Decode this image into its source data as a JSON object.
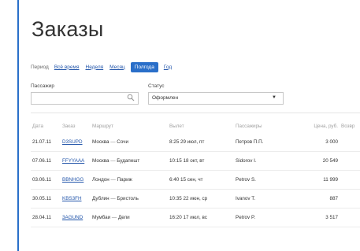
{
  "page": {
    "title": "Заказы"
  },
  "filters": {
    "period_label": "Период",
    "periods": [
      {
        "label": "Всё время",
        "active": false
      },
      {
        "label": "Неделя",
        "active": false
      },
      {
        "label": "Месяц",
        "active": false
      },
      {
        "label": "Полгода",
        "active": true
      },
      {
        "label": "Год",
        "active": false
      }
    ],
    "passenger_label": "Пассажир",
    "passenger_value": "",
    "status_label": "Статус",
    "status_value": "Оформлен"
  },
  "table": {
    "headers": [
      "Дата",
      "Заказ",
      "Маршрут",
      "Вылет",
      "Пассажиры",
      "Цена, руб.",
      "Возвр"
    ],
    "rows": [
      {
        "date": "21.07.11",
        "order": "D3SUPD",
        "from": "Москва",
        "to": "Сочи",
        "departure": "8:25 29 июл, пт",
        "passenger": "Петров П.П.",
        "price": "3 000"
      },
      {
        "date": "07.06.11",
        "order": "FFYYAAA",
        "from": "Москва",
        "to": "Будапешт",
        "departure": "10:15 18 окт, вт",
        "passenger": "Sidorov I.",
        "price": "20 549"
      },
      {
        "date": "03.06.11",
        "order": "BBNHGG",
        "from": "Лондон",
        "to": "Париж",
        "departure": "6:40 15 сен, чт",
        "passenger": "Petrov S.",
        "price": "11 999"
      },
      {
        "date": "30.05.11",
        "order": "KBS3FH",
        "from": "Дублин",
        "to": "Бристоль",
        "departure": "10:35 22 июн, ср",
        "passenger": "Ivanov T.",
        "price": "887"
      },
      {
        "date": "28.04.11",
        "order": "3AGUND",
        "from": "Мумбаи",
        "to": "Дели",
        "departure": "16:20 17 июл, вс",
        "passenger": "Petrov P.",
        "price": "3 517"
      }
    ]
  }
}
